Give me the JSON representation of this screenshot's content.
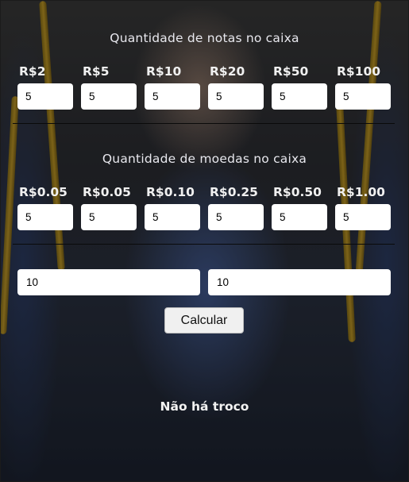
{
  "notes_section": {
    "title": "Quantidade de notas no caixa",
    "items": [
      {
        "label": "R$2",
        "value": "5"
      },
      {
        "label": "R$5",
        "value": "5"
      },
      {
        "label": "R$10",
        "value": "5"
      },
      {
        "label": "R$20",
        "value": "5"
      },
      {
        "label": "R$50",
        "value": "5"
      },
      {
        "label": "R$100",
        "value": "5"
      }
    ]
  },
  "coins_section": {
    "title": "Quantidade de moedas no caixa",
    "items": [
      {
        "label": "R$0.05",
        "value": "5"
      },
      {
        "label": "R$0.05",
        "value": "5"
      },
      {
        "label": "R$0.10",
        "value": "5"
      },
      {
        "label": "R$0.25",
        "value": "5"
      },
      {
        "label": "R$0.50",
        "value": "5"
      },
      {
        "label": "R$1.00",
        "value": "5"
      }
    ]
  },
  "amounts": {
    "first_value": "10",
    "second_value": "10"
  },
  "calculate_button": {
    "label": "Calcular"
  },
  "result": {
    "text": "Não há troco"
  }
}
